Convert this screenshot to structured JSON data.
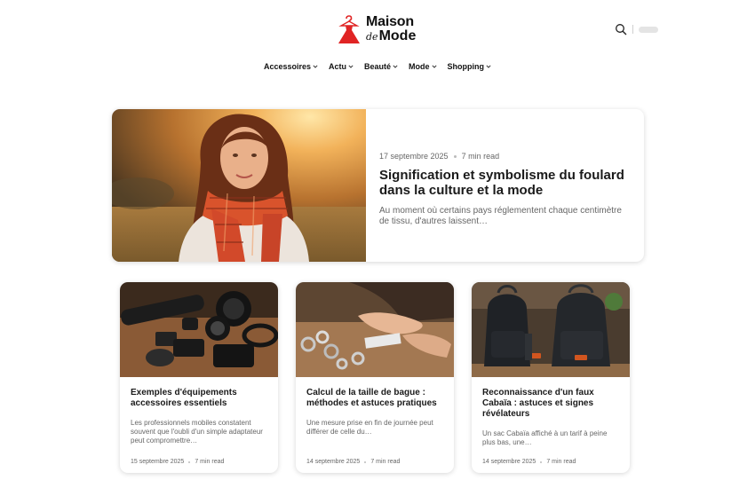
{
  "brand": {
    "line1": "Maison",
    "line2_prefix": "de",
    "line2": "Mode",
    "color": "#e02424"
  },
  "header": {
    "search_icon": "search-icon"
  },
  "nav": [
    {
      "label": "Accessoires"
    },
    {
      "label": "Actu"
    },
    {
      "label": "Beauté"
    },
    {
      "label": "Mode"
    },
    {
      "label": "Shopping"
    }
  ],
  "featured": {
    "date": "17 septembre 2025",
    "read_time": "7 min read",
    "title": "Signification et symbolisme du foulard dans la culture et la mode",
    "excerpt": "Au moment où certains pays réglementent chaque centimètre de tissu, d'autres laissent…"
  },
  "cards": [
    {
      "title": "Exemples d'équipements accessoires essentiels",
      "excerpt": "Les professionnels mobiles constatent souvent que l'oubli d'un simple adaptateur peut compromettre…",
      "date": "15 septembre 2025",
      "read_time": "7 min read"
    },
    {
      "title": "Calcul de la taille de bague : méthodes et astuces pratiques",
      "excerpt": "Une mesure prise en fin de journée peut différer de celle du…",
      "date": "14 septembre 2025",
      "read_time": "7 min read"
    },
    {
      "title": "Reconnaissance d'un faux Cabaïa : astuces et signes révélateurs",
      "excerpt": "Un sac Cabaïa affiché à un tarif à peine plus bas, une…",
      "date": "14 septembre 2025",
      "read_time": "7 min read"
    }
  ]
}
